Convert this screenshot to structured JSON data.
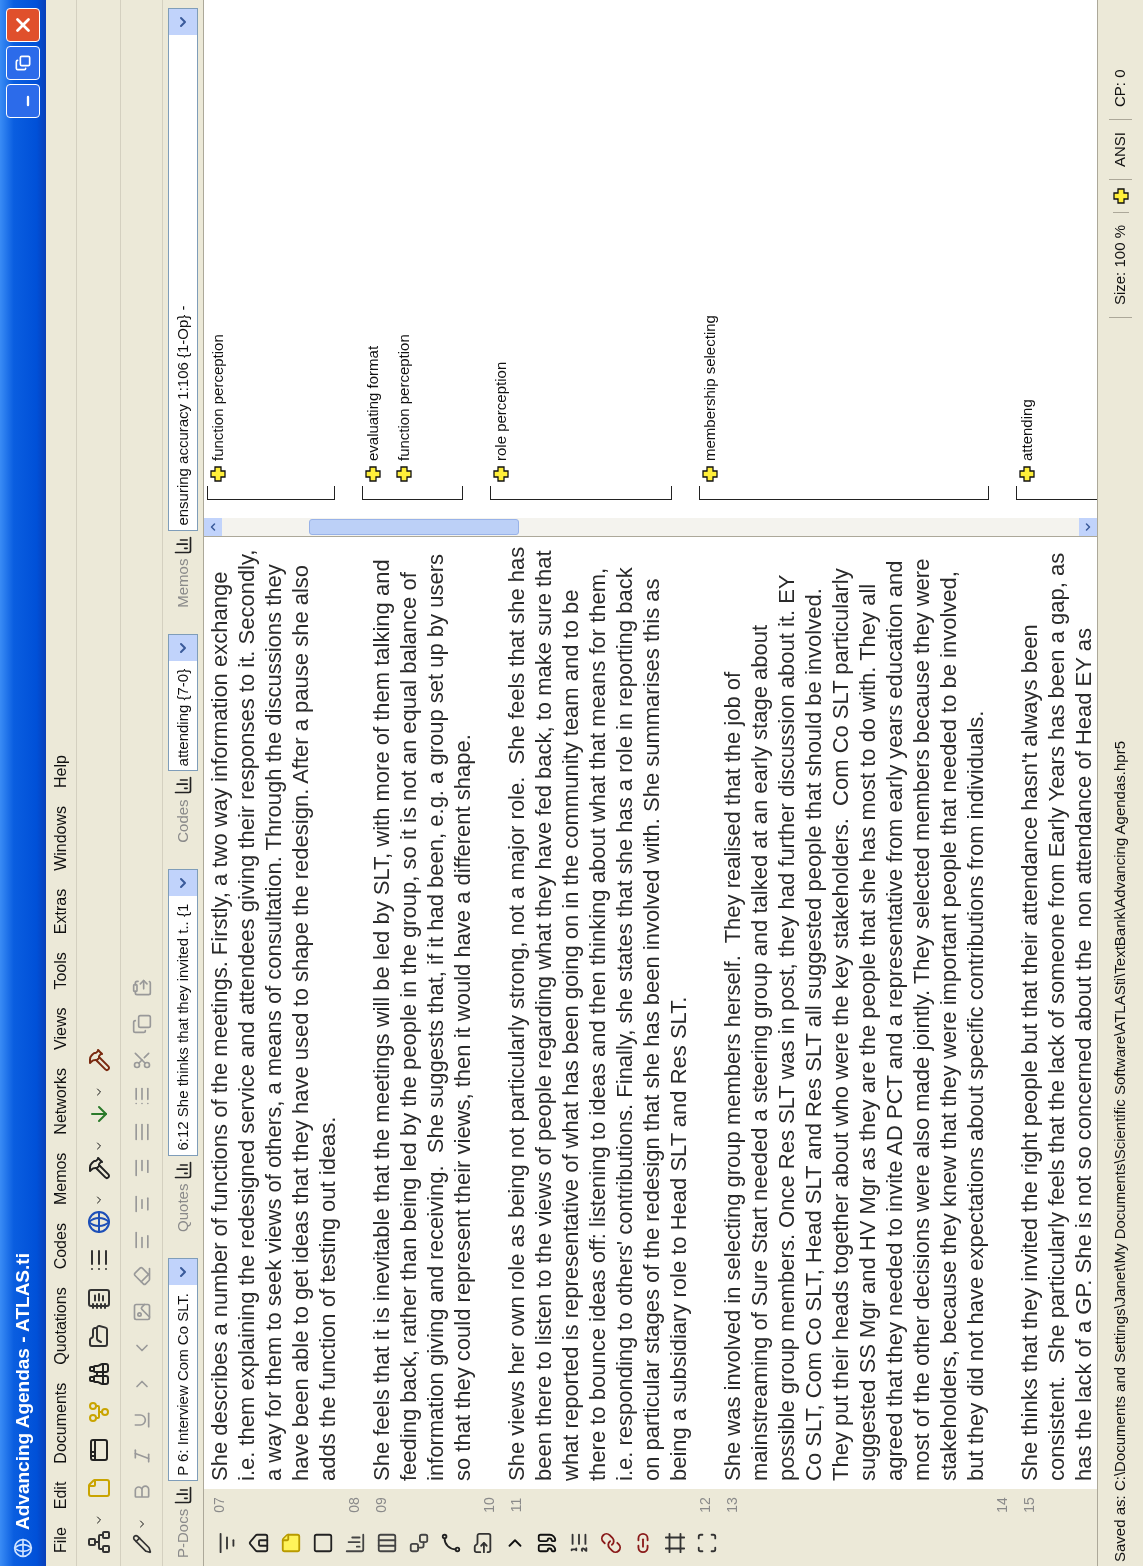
{
  "window": {
    "title": "Advancing Agendas - ATLAS.ti"
  },
  "menu": [
    "File",
    "Edit",
    "Documents",
    "Quotations",
    "Codes",
    "Memos",
    "Networks",
    "Views",
    "Tools",
    "Extras",
    "Windows",
    "Help"
  ],
  "selectors": [
    {
      "label": "P-Docs",
      "value": "P 6: Interview Com Co SLT."
    },
    {
      "label": "Quotes",
      "value": "6:12 She thinks that they invited t.. {1"
    },
    {
      "label": "Codes",
      "value": "attending {7-0}"
    },
    {
      "label": "Memos",
      "value": "ensuring accuracy 1:106 {1-Op} -"
    }
  ],
  "document": {
    "lines": [
      {
        "number": "07",
        "text": "She describes a number of functions of the meetings. Firstly, a two way information exchange i.e. them explaining the redesigned service and attendees giving their responses to it. Secondly, a way for them to seek views of others, a means of consultation. Through the discussions they have been able to get ideas that they have used to shape the redesign. After a pause she also adds the function of testing out ideas."
      },
      {
        "number": "08"
      },
      {
        "number": "09",
        "text": "She feels that it is inevitable that the meetings will be led by SLT, with more of them talking and feeding back, rather than being led by the people in the group, so it is not an equal balance of information giving and receiving.  She suggests that, if it had been, e.g. a group set up by users so that they could represent their views, then it would have a different shape."
      },
      {
        "number": "10"
      },
      {
        "number": "11",
        "text": "She views her own role as being not particularly strong, not a major role.  She feels that she has been there to listen to the views of people regarding what they have fed back, to make sure that what reported is representative of what has been going on in the community team and to be there to bounce ideas off: listening to ideas and then thinking about what that means for them, i.e. responding to others' contributions. Finally, she states that she has a role in reporting back on particular stages of the redesign that she has been involved with. She summarises this as being a subsidiary role to Head SLT and Res SLT."
      },
      {
        "number": "12"
      },
      {
        "number": "13",
        "text": "She was involved in selecting group members herself.  They realised that the job of mainstreaming of Sure Start needed a steering group and talked at an early stage about possible group members. Once Res SLT was in post, they had further discussion about it. EY Co SLT, Com Co SLT, Head SLT and Res SLT all suggested people that should be involved. They put their heads together about who were the key stakeholders.  Com Co SLT particularly suggested SS Mgr and HV Mgr as they are the people that she has most to do with. They all agreed that they needed to invite AD PCT and a representative from early years education and most of the other decisions were also made jointly. They selected members because they were stakeholders, because they knew that they were important people that needed to be involved, but they did not have expectations about specific contributions from individuals."
      },
      {
        "number": "14"
      },
      {
        "number": "15",
        "text": "She thinks that they invited the right people but that their attendance hasn't always been consistent.  She particularly feels that the lack of someone from Early Years has been a gap, as has the lack of a GP. She is not so concerned about the  non attendance of Head EY as"
      }
    ]
  },
  "margin": [
    {
      "codes": [
        "function perception"
      ]
    },
    {
      "codes": [
        "evaluating format",
        "function perception"
      ]
    },
    {
      "codes": [
        "role perception"
      ]
    },
    {
      "codes": [
        "membership selecting"
      ]
    },
    {
      "codes": [
        "attending"
      ]
    }
  ],
  "status_bar": {
    "path": "Saved as: C:\\Documents and Settings\\Janet\\My Documents\\Scientific Software\\ATLASti\\TextBank\\Advancing Agendas.hpr5",
    "size": "Size: 100 %",
    "encoding": "ANSI",
    "cp": "CP: 0"
  }
}
